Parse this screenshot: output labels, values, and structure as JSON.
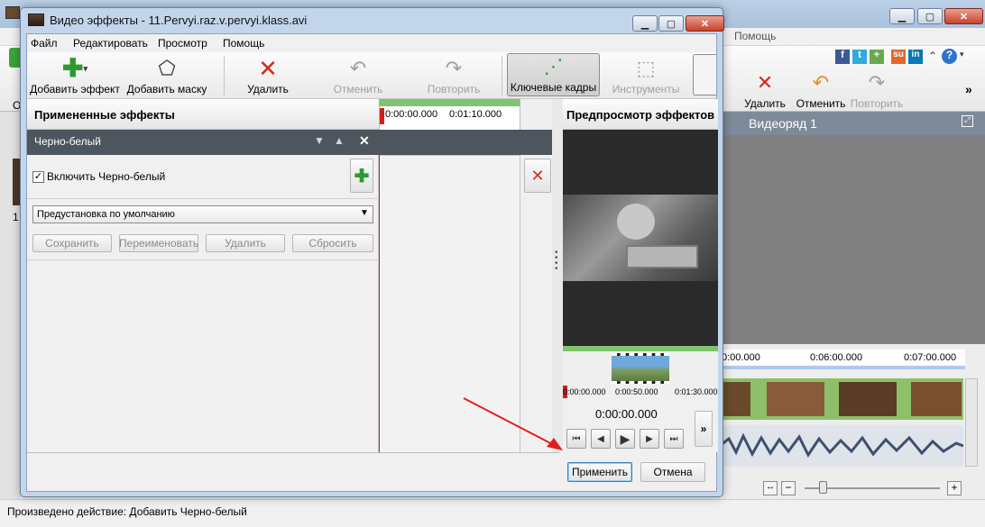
{
  "background_window": {
    "menu_help": "Помощь",
    "toolbar": {
      "delete": "Удалить",
      "undo": "Отменить",
      "redo": "Повторить"
    },
    "track_title": "Видеоряд 1",
    "timeline_ticks": [
      "0:00.000",
      "0:06:00.000",
      "0:07:00.000"
    ],
    "left_labels": [
      "О",
      "1"
    ],
    "status": "Произведено действие: Добавить Черно-белый"
  },
  "dialog": {
    "title": "Видео эффекты - 11.Pervyi.raz.v.pervyi.klass.avi",
    "menu": [
      "Файл",
      "Редактировать",
      "Просмотр",
      "Помощь"
    ],
    "toolbar": {
      "add_effect": "Добавить эффект",
      "add_mask": "Добавить маску",
      "delete": "Удалить",
      "undo": "Отменить",
      "redo": "Повторить",
      "keyframes": "Ключевые кадры",
      "tools": "Инструменты"
    },
    "applied_title": "Примененные эффекты",
    "timeline_ticks": [
      "0:00:00.000",
      "0:01:10.000"
    ],
    "effect_name": "Черно-белый",
    "enable_label": "Включить Черно-белый",
    "enable_checked": true,
    "preset_value": "Предустановка по умолчанию",
    "buttons": {
      "save": "Сохранить",
      "rename": "Переименовать",
      "delete": "Удалить",
      "reset": "Сбросить"
    },
    "preview_title": "Предпросмотр эффектов",
    "preview_ticks": [
      "0:00:00.000",
      "0:00:50.000",
      "0:01:30.000"
    ],
    "time_display": "0:00:00.000",
    "apply": "Применить",
    "cancel": "Отмена"
  },
  "colors": {
    "accent_green": "#2e9b2e",
    "red": "#d32b1f",
    "playhead": "#cc2020",
    "timeline_green": "#7fc46e"
  }
}
